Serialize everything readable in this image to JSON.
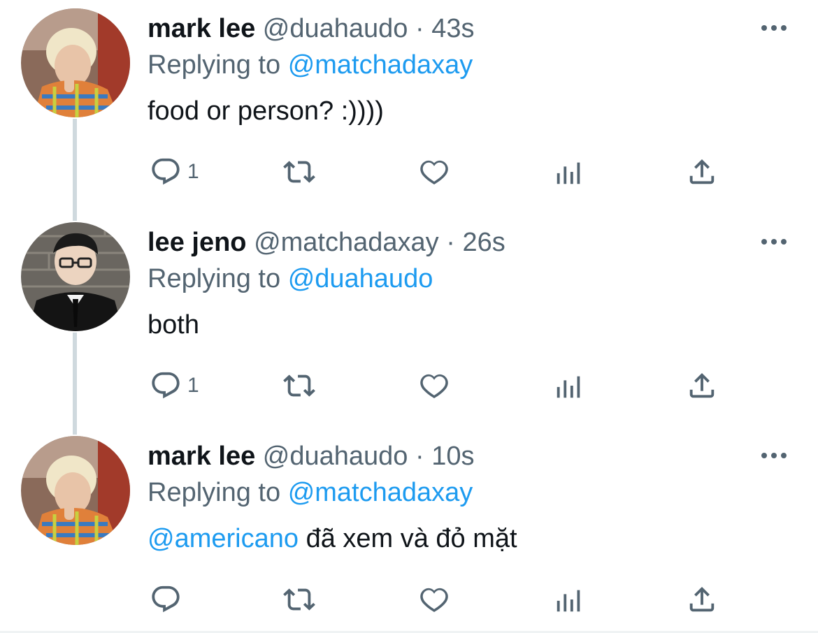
{
  "tweets": [
    {
      "name": "mark lee",
      "handle": "@duahaudo",
      "separator": "·",
      "time": "43s",
      "replying_prefix": "Replying to",
      "replying_to": "@matchadaxay",
      "mention": "",
      "text": "food or person? :))))",
      "reply_count": "1",
      "avatar": "mark-lee-avatar"
    },
    {
      "name": "lee jeno",
      "handle": "@matchadaxay",
      "separator": "·",
      "time": "26s",
      "replying_prefix": "Replying to",
      "replying_to": "@duahaudo",
      "mention": "",
      "text": "both",
      "reply_count": "1",
      "avatar": "lee-jeno-avatar"
    },
    {
      "name": "mark lee",
      "handle": "@duahaudo",
      "separator": "·",
      "time": "10s",
      "replying_prefix": "Replying to",
      "replying_to": "@matchadaxay",
      "mention": "@americano",
      "text": "đã xem và đỏ mặt",
      "reply_count": "",
      "avatar": "mark-lee-avatar"
    }
  ],
  "colors": {
    "name": "#0f1419",
    "secondary": "#536471",
    "link": "#1d9bf0",
    "thread_line": "#cfd9de"
  },
  "icons": [
    "reply-icon",
    "retweet-icon",
    "like-icon",
    "analytics-icon",
    "share-icon",
    "more-options-icon"
  ]
}
